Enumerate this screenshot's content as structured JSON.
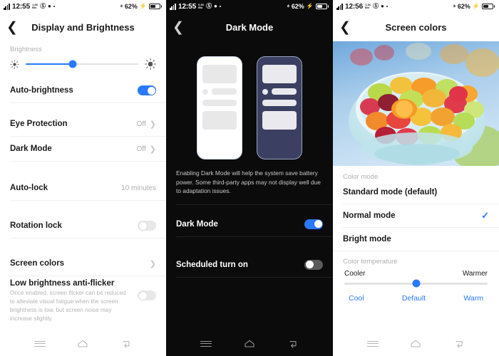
{
  "panels": [
    {
      "status": {
        "time": "12:55",
        "battery": "62%",
        "signal_label": "4G",
        "icons": [
          "signal-bars",
          "alarm",
          "dnd",
          "weather",
          "dot"
        ]
      },
      "title": "Display and Brightness",
      "back_icon": "back-chevron-icon",
      "brightness": {
        "label": "Brightness",
        "value_pct": 42,
        "left_icon": "sun-small-icon",
        "right_icon": "sun-large-icon"
      },
      "rows": [
        {
          "label": "Auto-brightness",
          "control": "toggle",
          "state": "on"
        },
        {
          "label": "Eye Protection",
          "value": "Off",
          "control": "chevron"
        },
        {
          "label": "Dark Mode",
          "value": "Off",
          "control": "chevron"
        },
        {
          "label": "Auto-lock",
          "value": "10 minutes",
          "control": "none"
        },
        {
          "label": "Rotation lock",
          "control": "toggle",
          "state": "off"
        },
        {
          "label": "Screen colors",
          "value": "",
          "control": "chevron"
        },
        {
          "label": "Low brightness anti-flicker",
          "desc": "Once enabled, screen flicker can be reduced to alleviate visual fatigue when the screen brightness is low, but screen noise may increase slightly.",
          "control": "toggle",
          "state": "off"
        }
      ]
    },
    {
      "status": {
        "time": "12:55",
        "battery": "62%",
        "signal_label": "4G"
      },
      "title": "Dark Mode",
      "back_icon": "back-chevron-icon",
      "preview": {
        "light_phone": "light-mode-preview",
        "dark_phone": "dark-mode-preview"
      },
      "description": "Enabling Dark Mode will help the system save battery power. Some third-party apps may not display well due to adaptation issues.",
      "rows": [
        {
          "label": "Dark Mode",
          "control": "toggle",
          "state": "on"
        },
        {
          "label": "Scheduled turn on",
          "control": "toggle",
          "state": "off"
        }
      ]
    },
    {
      "status": {
        "time": "12:56",
        "battery": "62%",
        "signal_label": "4G"
      },
      "title": "Screen colors",
      "back_icon": "back-chevron-icon",
      "photo_alt": "fruit-salad-bowl-photo",
      "color_mode": {
        "label": "Color mode",
        "options": [
          {
            "label": "Standard mode (default)",
            "selected": false
          },
          {
            "label": "Normal mode",
            "selected": true
          },
          {
            "label": "Bright mode",
            "selected": false
          }
        ]
      },
      "color_temperature": {
        "label": "Color temperature",
        "left_end": "Cooler",
        "right_end": "Warmer",
        "value_pct": 50,
        "presets": [
          "Cool",
          "Default",
          "Warm"
        ]
      }
    }
  ],
  "navbar": {
    "menu": "menu-icon",
    "home": "home-icon",
    "back": "back-icon"
  },
  "colors": {
    "accent": "#2979ff",
    "dark_bg": "#0b0b0b",
    "dark_phone": "#3b4062",
    "muted": "#b0b0b0"
  }
}
